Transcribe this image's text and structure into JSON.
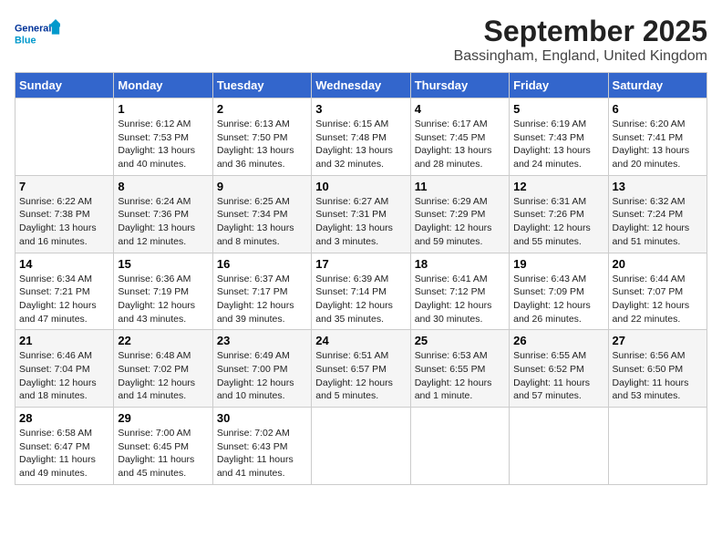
{
  "header": {
    "logo_general": "General",
    "logo_blue": "Blue",
    "month": "September 2025",
    "location": "Bassingham, England, United Kingdom"
  },
  "days_of_week": [
    "Sunday",
    "Monday",
    "Tuesday",
    "Wednesday",
    "Thursday",
    "Friday",
    "Saturday"
  ],
  "weeks": [
    [
      {
        "day": "",
        "sunrise": "",
        "sunset": "",
        "daylight": ""
      },
      {
        "day": "1",
        "sunrise": "Sunrise: 6:12 AM",
        "sunset": "Sunset: 7:53 PM",
        "daylight": "Daylight: 13 hours and 40 minutes."
      },
      {
        "day": "2",
        "sunrise": "Sunrise: 6:13 AM",
        "sunset": "Sunset: 7:50 PM",
        "daylight": "Daylight: 13 hours and 36 minutes."
      },
      {
        "day": "3",
        "sunrise": "Sunrise: 6:15 AM",
        "sunset": "Sunset: 7:48 PM",
        "daylight": "Daylight: 13 hours and 32 minutes."
      },
      {
        "day": "4",
        "sunrise": "Sunrise: 6:17 AM",
        "sunset": "Sunset: 7:45 PM",
        "daylight": "Daylight: 13 hours and 28 minutes."
      },
      {
        "day": "5",
        "sunrise": "Sunrise: 6:19 AM",
        "sunset": "Sunset: 7:43 PM",
        "daylight": "Daylight: 13 hours and 24 minutes."
      },
      {
        "day": "6",
        "sunrise": "Sunrise: 6:20 AM",
        "sunset": "Sunset: 7:41 PM",
        "daylight": "Daylight: 13 hours and 20 minutes."
      }
    ],
    [
      {
        "day": "7",
        "sunrise": "Sunrise: 6:22 AM",
        "sunset": "Sunset: 7:38 PM",
        "daylight": "Daylight: 13 hours and 16 minutes."
      },
      {
        "day": "8",
        "sunrise": "Sunrise: 6:24 AM",
        "sunset": "Sunset: 7:36 PM",
        "daylight": "Daylight: 13 hours and 12 minutes."
      },
      {
        "day": "9",
        "sunrise": "Sunrise: 6:25 AM",
        "sunset": "Sunset: 7:34 PM",
        "daylight": "Daylight: 13 hours and 8 minutes."
      },
      {
        "day": "10",
        "sunrise": "Sunrise: 6:27 AM",
        "sunset": "Sunset: 7:31 PM",
        "daylight": "Daylight: 13 hours and 3 minutes."
      },
      {
        "day": "11",
        "sunrise": "Sunrise: 6:29 AM",
        "sunset": "Sunset: 7:29 PM",
        "daylight": "Daylight: 12 hours and 59 minutes."
      },
      {
        "day": "12",
        "sunrise": "Sunrise: 6:31 AM",
        "sunset": "Sunset: 7:26 PM",
        "daylight": "Daylight: 12 hours and 55 minutes."
      },
      {
        "day": "13",
        "sunrise": "Sunrise: 6:32 AM",
        "sunset": "Sunset: 7:24 PM",
        "daylight": "Daylight: 12 hours and 51 minutes."
      }
    ],
    [
      {
        "day": "14",
        "sunrise": "Sunrise: 6:34 AM",
        "sunset": "Sunset: 7:21 PM",
        "daylight": "Daylight: 12 hours and 47 minutes."
      },
      {
        "day": "15",
        "sunrise": "Sunrise: 6:36 AM",
        "sunset": "Sunset: 7:19 PM",
        "daylight": "Daylight: 12 hours and 43 minutes."
      },
      {
        "day": "16",
        "sunrise": "Sunrise: 6:37 AM",
        "sunset": "Sunset: 7:17 PM",
        "daylight": "Daylight: 12 hours and 39 minutes."
      },
      {
        "day": "17",
        "sunrise": "Sunrise: 6:39 AM",
        "sunset": "Sunset: 7:14 PM",
        "daylight": "Daylight: 12 hours and 35 minutes."
      },
      {
        "day": "18",
        "sunrise": "Sunrise: 6:41 AM",
        "sunset": "Sunset: 7:12 PM",
        "daylight": "Daylight: 12 hours and 30 minutes."
      },
      {
        "day": "19",
        "sunrise": "Sunrise: 6:43 AM",
        "sunset": "Sunset: 7:09 PM",
        "daylight": "Daylight: 12 hours and 26 minutes."
      },
      {
        "day": "20",
        "sunrise": "Sunrise: 6:44 AM",
        "sunset": "Sunset: 7:07 PM",
        "daylight": "Daylight: 12 hours and 22 minutes."
      }
    ],
    [
      {
        "day": "21",
        "sunrise": "Sunrise: 6:46 AM",
        "sunset": "Sunset: 7:04 PM",
        "daylight": "Daylight: 12 hours and 18 minutes."
      },
      {
        "day": "22",
        "sunrise": "Sunrise: 6:48 AM",
        "sunset": "Sunset: 7:02 PM",
        "daylight": "Daylight: 12 hours and 14 minutes."
      },
      {
        "day": "23",
        "sunrise": "Sunrise: 6:49 AM",
        "sunset": "Sunset: 7:00 PM",
        "daylight": "Daylight: 12 hours and 10 minutes."
      },
      {
        "day": "24",
        "sunrise": "Sunrise: 6:51 AM",
        "sunset": "Sunset: 6:57 PM",
        "daylight": "Daylight: 12 hours and 5 minutes."
      },
      {
        "day": "25",
        "sunrise": "Sunrise: 6:53 AM",
        "sunset": "Sunset: 6:55 PM",
        "daylight": "Daylight: 12 hours and 1 minute."
      },
      {
        "day": "26",
        "sunrise": "Sunrise: 6:55 AM",
        "sunset": "Sunset: 6:52 PM",
        "daylight": "Daylight: 11 hours and 57 minutes."
      },
      {
        "day": "27",
        "sunrise": "Sunrise: 6:56 AM",
        "sunset": "Sunset: 6:50 PM",
        "daylight": "Daylight: 11 hours and 53 minutes."
      }
    ],
    [
      {
        "day": "28",
        "sunrise": "Sunrise: 6:58 AM",
        "sunset": "Sunset: 6:47 PM",
        "daylight": "Daylight: 11 hours and 49 minutes."
      },
      {
        "day": "29",
        "sunrise": "Sunrise: 7:00 AM",
        "sunset": "Sunset: 6:45 PM",
        "daylight": "Daylight: 11 hours and 45 minutes."
      },
      {
        "day": "30",
        "sunrise": "Sunrise: 7:02 AM",
        "sunset": "Sunset: 6:43 PM",
        "daylight": "Daylight: 11 hours and 41 minutes."
      },
      {
        "day": "",
        "sunrise": "",
        "sunset": "",
        "daylight": ""
      },
      {
        "day": "",
        "sunrise": "",
        "sunset": "",
        "daylight": ""
      },
      {
        "day": "",
        "sunrise": "",
        "sunset": "",
        "daylight": ""
      },
      {
        "day": "",
        "sunrise": "",
        "sunset": "",
        "daylight": ""
      }
    ]
  ]
}
